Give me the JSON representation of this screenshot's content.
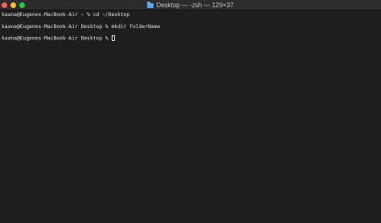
{
  "window": {
    "title": "Desktop — -zsh — 129×37",
    "title_icon": "folder-icon",
    "colors": {
      "background": "#1e1e1e",
      "titlebar": "#2c2c2c",
      "close": "#ff5f57",
      "minimize": "#febc2e",
      "zoom": "#28c840",
      "text": "#e6e6e6",
      "folder": "#5aa9f5"
    }
  },
  "terminal": {
    "lines": [
      {
        "prompt": "kaana@Eugenes-MacBook-Air ~ % ",
        "command": "cd ~/Desktop"
      },
      {
        "prompt": "kaana@Eugenes-MacBook-Air Desktop % ",
        "command": "mkdir FolderName"
      },
      {
        "prompt": "kaana@Eugenes-MacBook-Air Desktop % ",
        "command": ""
      }
    ]
  }
}
